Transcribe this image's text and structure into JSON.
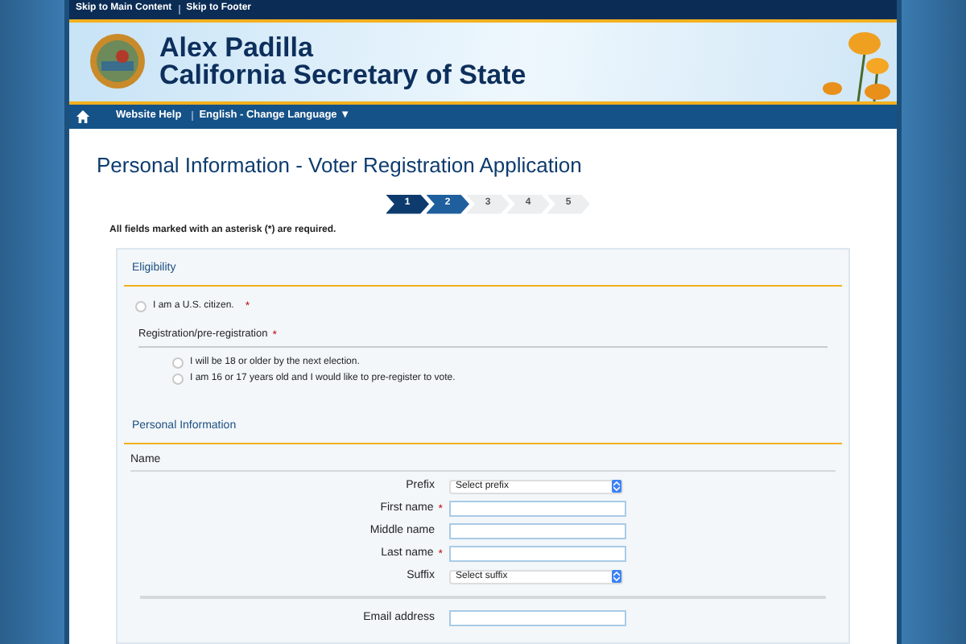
{
  "skip_links": [
    "Skip to Main Content",
    "Skip to Footer"
  ],
  "banner": {
    "name": "Alex Padilla",
    "office": "California Secretary of State"
  },
  "nav": {
    "items": [
      "Website Help",
      "English - Change Language ▼"
    ]
  },
  "page_title": "Personal Information - Voter Registration Application",
  "steps": [
    {
      "label": "1",
      "completed": true,
      "selected": false
    },
    {
      "label": "2",
      "completed": false,
      "selected": true
    },
    {
      "label": "3",
      "completed": false,
      "selected": false
    },
    {
      "label": "4",
      "completed": false,
      "selected": false
    },
    {
      "label": "5",
      "completed": false,
      "selected": false
    }
  ],
  "required_note": "All fields marked with an asterisk (*) are required.",
  "eligibility": {
    "heading": "Eligibility",
    "citizen": {
      "label": "I am a U.S. citizen.",
      "checked": false,
      "asterisk": "*"
    },
    "registration": {
      "label": "Registration/pre-registration",
      "asterisk": "*",
      "options": [
        {
          "label": "I will be 18 or older by the next election.",
          "selected": false
        },
        {
          "label": "I am 16 or 17 years old and I would like to pre-register to vote.",
          "selected": false
        }
      ]
    }
  },
  "personal": {
    "heading": "Personal Information",
    "subheading": "Name",
    "fields": [
      {
        "kind": "select",
        "label": "Prefix",
        "placeholder": "Select prefix"
      },
      {
        "kind": "input",
        "label": "First name",
        "asterisk": "*"
      },
      {
        "kind": "input",
        "label": "Middle name"
      },
      {
        "kind": "input",
        "label": "Last name",
        "asterisk": "*"
      },
      {
        "kind": "select",
        "label": "Suffix",
        "placeholder": "Select suffix"
      },
      {
        "kind": "divider"
      },
      {
        "kind": "input",
        "label": "Email address"
      }
    ]
  }
}
